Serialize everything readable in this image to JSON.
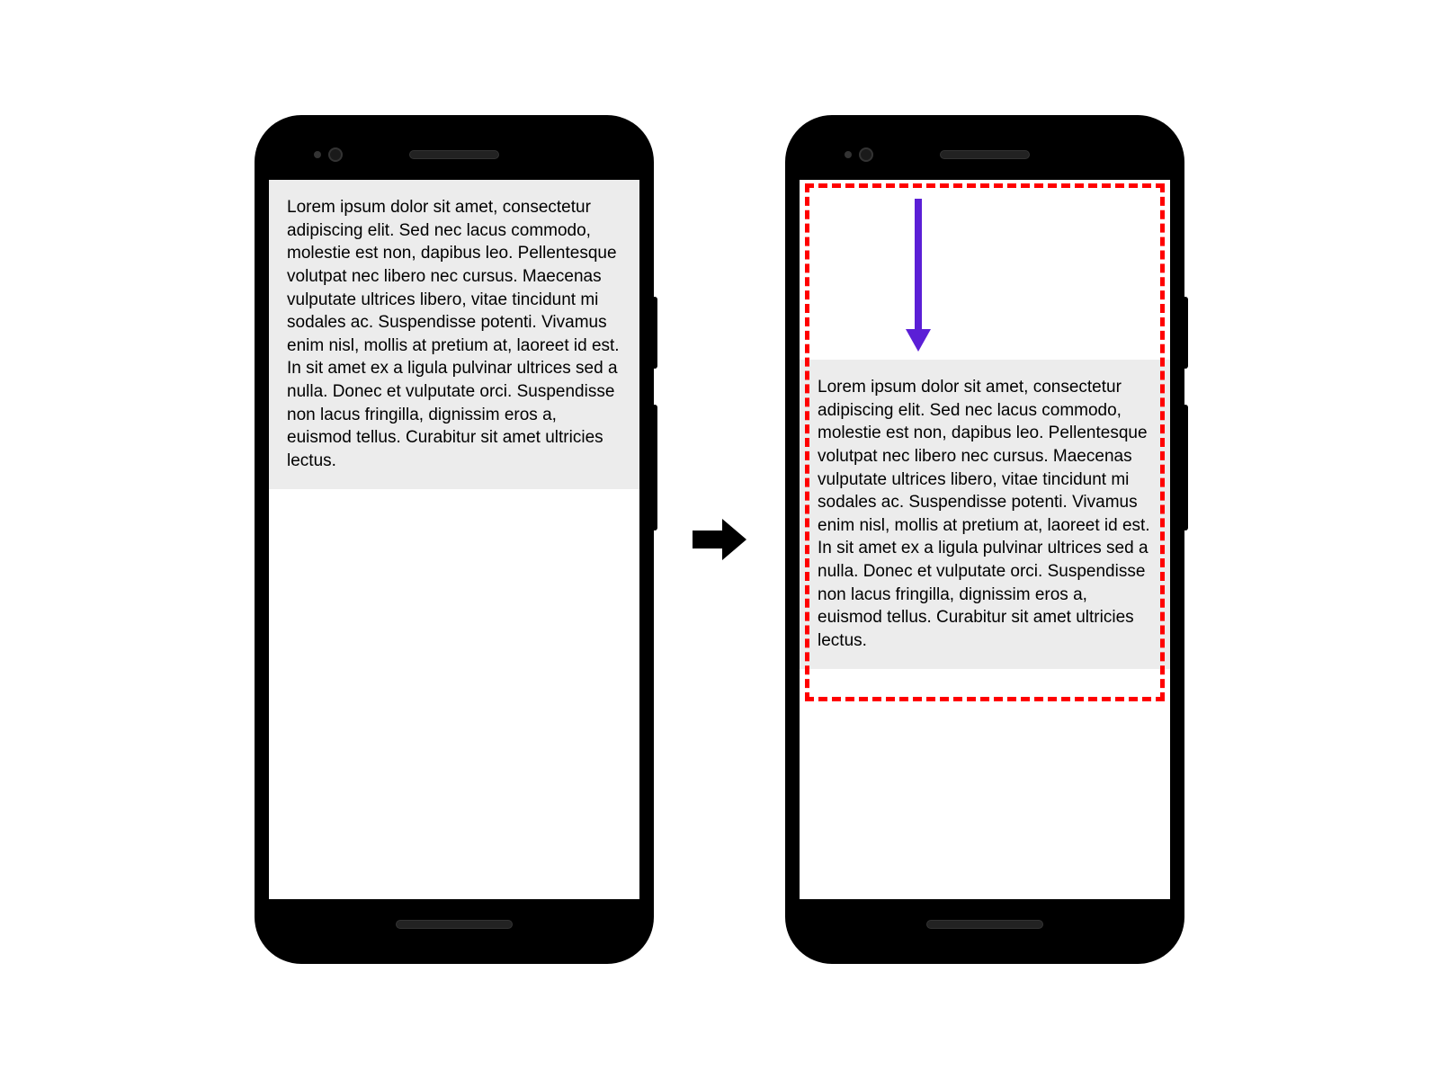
{
  "loremText": "Lorem ipsum dolor sit amet, consectetur adipiscing elit. Sed nec lacus commodo, molestie est non, dapibus leo. Pellentesque volutpat nec libero nec cursus. Maecenas vulputate ultrices libero, vitae tincidunt mi sodales ac. Suspendisse potenti. Vivamus enim nisl, mollis at pretium at, laoreet id est. In sit amet ex a ligula pulvinar ultrices sed a nulla. Donec et vulputate orci. Suspendisse non lacus fringilla, dignissim eros a, euismod tellus. Curabitur sit amet ultricies lectus.",
  "colors": {
    "selectionBorder": "#ff0000",
    "arrowPurple": "#5b1fd6",
    "textBackground": "#ececec"
  }
}
